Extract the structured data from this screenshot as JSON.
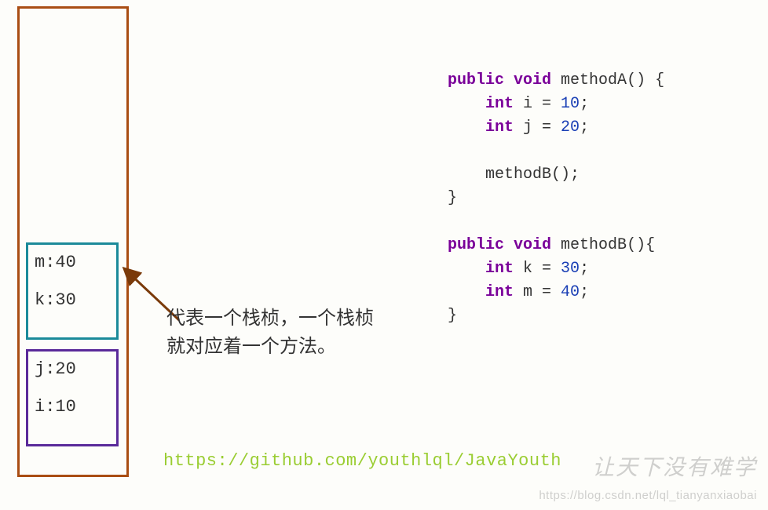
{
  "stack": {
    "frames": [
      {
        "id": "frame-b",
        "lines": [
          "m:40",
          "k:30"
        ]
      },
      {
        "id": "frame-a",
        "lines": [
          "j:20",
          "i:10"
        ]
      }
    ]
  },
  "annotation": {
    "line1": "代表一个栈桢，一个栈桢",
    "line2": "就对应着一个方法。"
  },
  "url": "https://github.com/youthlql/JavaYouth",
  "code": {
    "methodA": {
      "signature_kw1": "public",
      "signature_kw2": "void",
      "signature_name": " methodA() {",
      "line1_kw": "int",
      "line1_rest": " i = ",
      "line1_num": "10",
      "line2_kw": "int",
      "line2_rest": " j = ",
      "line2_num": "20",
      "call": "methodB();",
      "close": "}"
    },
    "methodB": {
      "signature_kw1": "public",
      "signature_kw2": "void",
      "signature_name": " methodB(){",
      "line1_kw": "int",
      "line1_rest": " k = ",
      "line1_num": "30",
      "line2_kw": "int",
      "line2_rest": " m = ",
      "line2_num": "40",
      "close": "}"
    }
  },
  "watermark": {
    "text1": "让天下没有难学",
    "text2": "https://blog.csdn.net/lql_tianyanxiaobai"
  }
}
